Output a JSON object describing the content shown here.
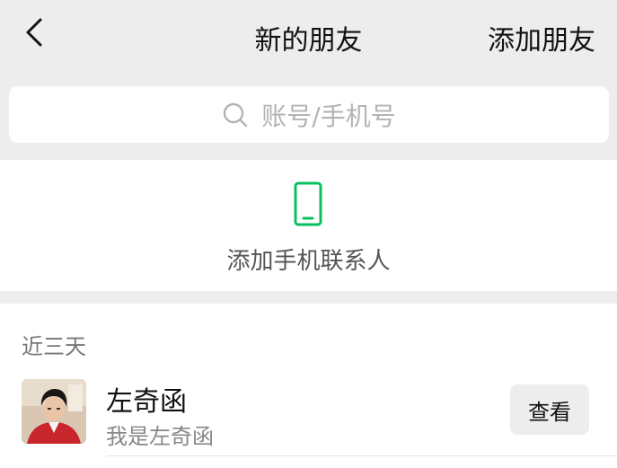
{
  "header": {
    "title": "新的朋友",
    "add_friend_label": "添加朋友",
    "back_icon": "chevron-left-icon"
  },
  "search": {
    "placeholder": "账号/手机号",
    "icon": "search-icon"
  },
  "add_contacts": {
    "label": "添加手机联系人",
    "icon": "phone-icon",
    "icon_color": "#07c160"
  },
  "recent": {
    "header": "近三天",
    "items": [
      {
        "name": "左奇函",
        "message": "我是左奇函",
        "action_label": "查看"
      }
    ]
  },
  "colors": {
    "background": "#ededed",
    "card": "#ffffff",
    "accent_green": "#07c160",
    "secondary_text": "#888888"
  }
}
